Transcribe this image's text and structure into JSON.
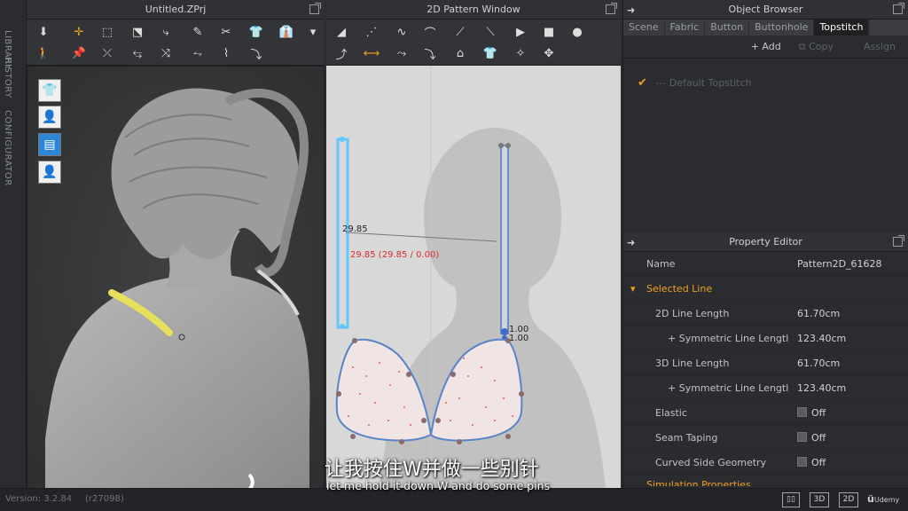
{
  "sidebar": {
    "tabs": [
      "LIBRARY",
      "HISTORY",
      "CONFIGURATOR"
    ]
  },
  "panel3d": {
    "title": "Untitled.ZPrj",
    "view_icons": [
      "garment-display-icon",
      "avatar-display-icon",
      "fabric-display-icon",
      "avatar-silhouette-icon"
    ]
  },
  "panel2d": {
    "title": "2D Pattern Window",
    "measure_label": "29.85",
    "measure_detail": "29.85 (29.85 / 0.00)",
    "point_label_1": "1.00",
    "point_label_2": "1.00"
  },
  "object_browser": {
    "title": "Object Browser",
    "tabs": [
      "Scene",
      "Fabric",
      "Button",
      "Buttonhole",
      "Topstitch"
    ],
    "active_tab": "Topstitch",
    "add_label": "+ Add",
    "copy_label": "Copy",
    "assign_label": "Assign",
    "item_label": "--- Default Topstitch"
  },
  "property_editor": {
    "title": "Property Editor",
    "name_label": "Name",
    "name_value": "Pattern2D_61628",
    "section_label": "Selected Line",
    "rows": [
      {
        "label": "2D Line Length",
        "value": "61.70cm"
      },
      {
        "label": "+ Symmetric Line Lengtl",
        "value": "123.40cm"
      },
      {
        "label": "3D Line Length",
        "value": "61.70cm"
      },
      {
        "label": "+ Symmetric Line Lengtl",
        "value": "123.40cm"
      },
      {
        "label": "Elastic",
        "value": "Off"
      },
      {
        "label": "Seam Taping",
        "value": "Off"
      },
      {
        "label": "Curved Side Geometry",
        "value": "Off"
      }
    ],
    "next_section": "Simulation Properties"
  },
  "status": {
    "version": "Version: 3.2.84",
    "build": "(r27098)",
    "btn_3d": "3D",
    "btn_2d": "2D",
    "brand": "Udemy"
  },
  "subtitles": {
    "cn": "让我按住W并做一些别针",
    "en": "let me hold it down W and do some pins"
  },
  "colors": {
    "accent_orange": "#f0a020",
    "selected_blue": "#63c7ff",
    "measure_red": "#e0282b",
    "strap_yellow": "#e6e05a"
  }
}
